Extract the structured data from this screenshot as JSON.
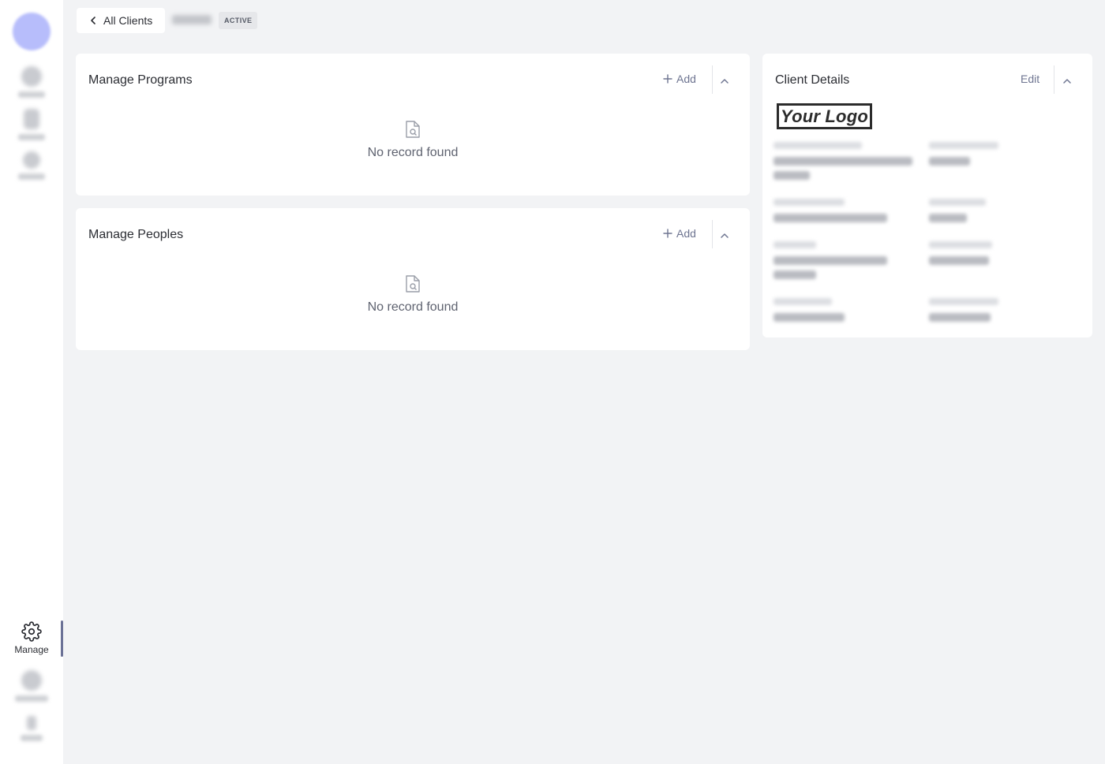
{
  "sidebar": {
    "manage_label": "Manage"
  },
  "topbar": {
    "back_label": "All Clients",
    "status": "ACTIVE"
  },
  "programs": {
    "title": "Manage Programs",
    "add_label": "Add",
    "empty_text": "No record found"
  },
  "peoples": {
    "title": "Manage Peoples",
    "add_label": "Add",
    "empty_text": "No record found"
  },
  "client_details": {
    "title": "Client Details",
    "edit_label": "Edit",
    "logo_text": "Your Logo"
  },
  "colors": {
    "accent": "#6e7591",
    "avatar": "#b7bdfb",
    "background": "#f2f3f5",
    "card": "#ffffff"
  },
  "icons": {
    "back": "chevron-left-icon",
    "add": "plus-icon",
    "collapse": "chevron-up-icon",
    "empty": "document-search-icon",
    "manage": "gear-icon"
  }
}
